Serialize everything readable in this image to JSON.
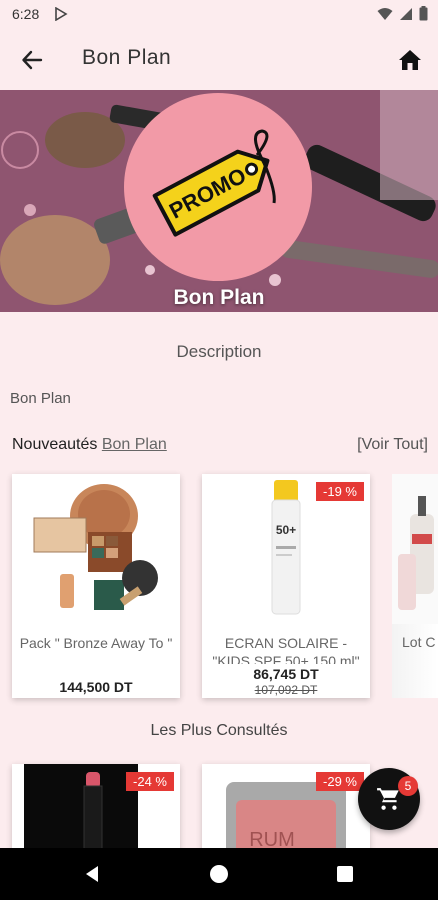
{
  "status": {
    "time": "6:28"
  },
  "appbar": {
    "title": "Bon Plan"
  },
  "banner": {
    "badge_text": "PROMO",
    "title": "Bon Plan"
  },
  "description": {
    "header": "Description",
    "body": "Bon Plan"
  },
  "nouveautes": {
    "label": "Nouveautés",
    "link": "Bon Plan",
    "voir_tout": "[Voir Tout]",
    "products": [
      {
        "name": "Pack \" Bronze Away To \"",
        "price": "144,500 DT"
      },
      {
        "name": "ECRAN SOLAIRE - \"KIDS SPF 50+ 150 ml\"",
        "price": "86,745 DT",
        "old_price": "107,092 DT",
        "discount": "-19 %"
      },
      {
        "name": "Lot C"
      }
    ]
  },
  "plus_consultes": {
    "header": "Les Plus Consultés",
    "products": [
      {
        "discount": "-24 %"
      },
      {
        "discount": "-29 %",
        "brand": "RUM"
      }
    ]
  },
  "cart": {
    "count": "5"
  },
  "colors": {
    "accent_red": "#e53935",
    "background": "#fcecee",
    "promo_circle": "#f29aa7",
    "promo_tag": "#f4d21b"
  }
}
